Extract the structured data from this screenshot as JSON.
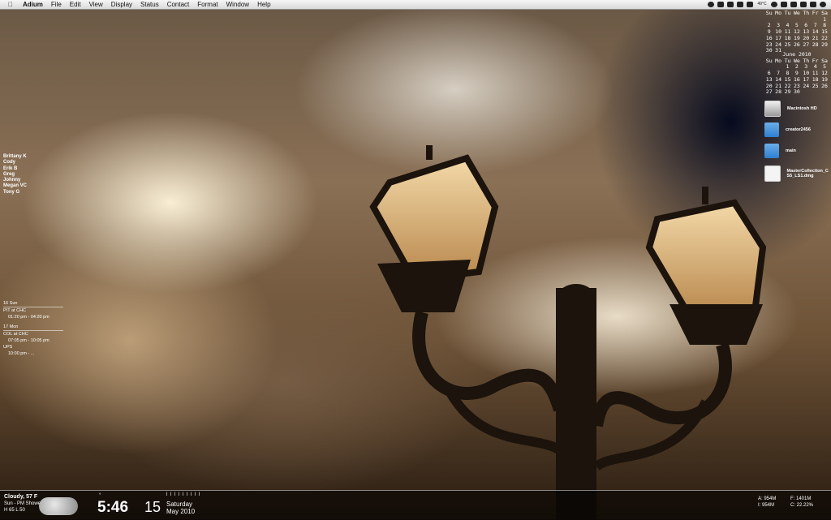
{
  "menubar": {
    "app_name": "Adium",
    "items": [
      "File",
      "Edit",
      "View",
      "Display",
      "Status",
      "Contact",
      "Format",
      "Window",
      "Help"
    ],
    "temperature": "49°C"
  },
  "calendar1": {
    "weekdays": [
      "Su",
      "Mo",
      "Tu",
      "We",
      "Th",
      "Fr",
      "Sa"
    ],
    "weeks": [
      [
        "",
        "",
        "",
        "",
        "",
        "",
        "1"
      ],
      [
        "2",
        "3",
        "4",
        "5",
        "6",
        "7",
        "8"
      ],
      [
        "9",
        "10",
        "11",
        "12",
        "13",
        "14",
        "15"
      ],
      [
        "16",
        "17",
        "18",
        "19",
        "20",
        "21",
        "22"
      ],
      [
        "23",
        "24",
        "25",
        "26",
        "27",
        "28",
        "29"
      ],
      [
        "30",
        "31",
        "",
        "",
        "",
        "",
        ""
      ]
    ]
  },
  "calendar2": {
    "month": "June 2010",
    "weekdays": [
      "Su",
      "Mo",
      "Tu",
      "We",
      "Th",
      "Fr",
      "Sa"
    ],
    "weeks": [
      [
        "",
        "",
        "1",
        "2",
        "3",
        "4",
        "5"
      ],
      [
        "6",
        "7",
        "8",
        "9",
        "10",
        "11",
        "12"
      ],
      [
        "13",
        "14",
        "15",
        "16",
        "17",
        "18",
        "19"
      ],
      [
        "20",
        "21",
        "22",
        "23",
        "24",
        "25",
        "26"
      ],
      [
        "27",
        "28",
        "29",
        "30",
        "",
        "",
        ""
      ]
    ]
  },
  "desktop_icons": [
    {
      "label": "Macintosh HD",
      "icon": "hard-drive"
    },
    {
      "label": "creator2456",
      "icon": "user-folder"
    },
    {
      "label": "main",
      "icon": "shared-folder"
    },
    {
      "label": "MasterCollection_CS5_LS1.dmg",
      "icon": "disk-image"
    }
  ],
  "buddies": {
    "online": [
      "Brittany K",
      "Cody",
      "Erik B",
      "Greg",
      "Johnny",
      "Megan VC",
      "Tony G"
    ],
    "idle": [
      "",
      "",
      "",
      "",
      "",
      "",
      ""
    ]
  },
  "schedule": [
    {
      "date": "16 Sun",
      "events": [
        {
          "title": "PIT at CHC",
          "time": "01:20 pm - 04:20 pm"
        }
      ]
    },
    {
      "date": "17 Mon",
      "events": [
        {
          "title": "COL at CHC",
          "time": "07:05 pm - 10:05 pm"
        },
        {
          "title": "UPS",
          "time": "10:00 pm - ..."
        }
      ]
    }
  ],
  "weather": {
    "current": "Cloudy, 57 F",
    "forecast": "Sun - PM Showers",
    "hilo": "H 65  L 50"
  },
  "clock": {
    "time": "5:46",
    "degree": "°",
    "day": "15",
    "ticks": "l l l l l l l l l",
    "weekday": "Saturday",
    "month_year": "May 2010"
  },
  "system_stats": {
    "a": "A: 954M",
    "i": "I: 954M",
    "f": "F: 1401M",
    "c": "C: 22.22%"
  }
}
